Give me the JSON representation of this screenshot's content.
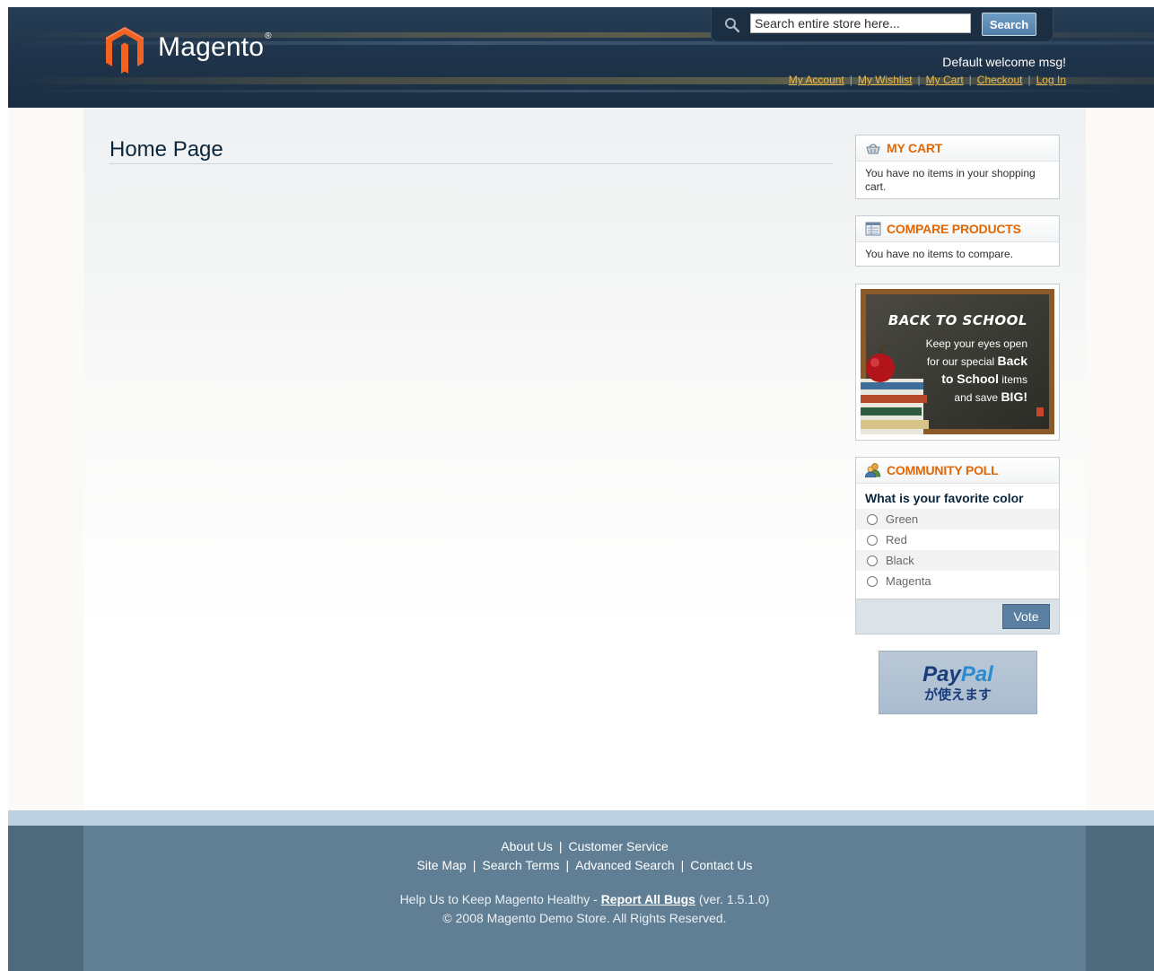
{
  "header": {
    "logo_text": "Magento",
    "logo_mark": "®",
    "search": {
      "placeholder": "Search entire store here...",
      "button_label": "Search"
    },
    "welcome": "Default welcome msg!",
    "links": [
      "My Account",
      "My Wishlist",
      "My Cart",
      "Checkout",
      "Log In"
    ]
  },
  "main": {
    "page_title": "Home Page"
  },
  "sidebar": {
    "cart": {
      "title": "My Cart",
      "text": "You have no items in your shopping cart."
    },
    "compare": {
      "title": "Compare Products",
      "text": "You have no items to compare."
    },
    "banner": {
      "heading": "BACK TO SCHOOL",
      "line1": "Keep your eyes open",
      "line2a": "for our special ",
      "line2b": "Back",
      "line3a": "to School",
      "line3b": " items",
      "line4a": "and save ",
      "line4b": "BIG!"
    },
    "poll": {
      "title": "Community Poll",
      "question": "What is your favorite color",
      "options": [
        "Green",
        "Red",
        "Black",
        "Magenta"
      ],
      "vote_label": "Vote"
    },
    "paypal": {
      "brand_a": "Pay",
      "brand_b": "Pal",
      "tagline": "が使えます"
    }
  },
  "footer": {
    "row1": [
      "About Us",
      "Customer Service"
    ],
    "row2": [
      "Site Map",
      "Search Terms",
      "Advanced Search",
      "Contact Us"
    ],
    "help_prefix": "Help Us to Keep Magento Healthy - ",
    "help_link": "Report All Bugs",
    "help_suffix": " (ver. 1.5.1.0)",
    "copyright": "© 2008 Magento Demo Store. All Rights Reserved."
  },
  "colors": {
    "header_bg": "#1e3349",
    "accent_orange": "#e26703",
    "link_gold": "#ebbb4e",
    "footer_bg": "#607f95",
    "button_blue": "#5a7fa0"
  }
}
